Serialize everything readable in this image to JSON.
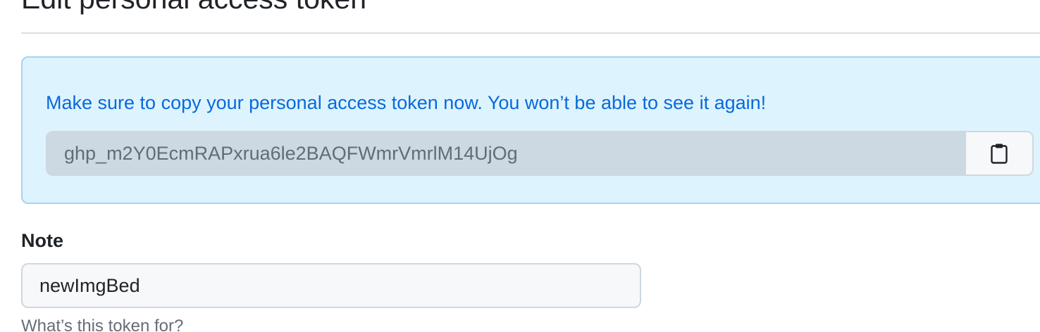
{
  "page": {
    "title": "Edit personal access token"
  },
  "flash": {
    "message": "Make sure to copy your personal access token now. You won’t be able to see it again!",
    "token_value": "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",
    "copy_icon": "clipboard-icon"
  },
  "note": {
    "label": "Note",
    "value": "newImgBed",
    "help_text": "What’s this token for?"
  },
  "colors": {
    "flash_background": "#ddf4ff",
    "flash_text": "#0969da",
    "token_field_background": "#ccd9e2"
  }
}
